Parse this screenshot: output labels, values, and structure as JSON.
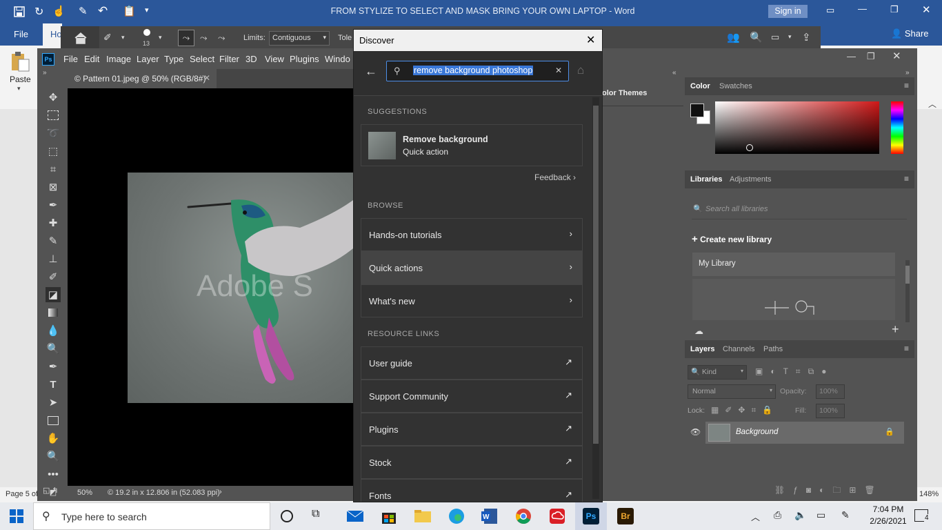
{
  "word": {
    "title": "FROM STYLIZE TO SELECT AND MASK BRING YOUR OWN LAPTOP  -  Word",
    "sign_in": "Sign in",
    "share": "Share",
    "file_tab": "File",
    "home_tab": "Ho",
    "paste_label": "Paste",
    "status_page": "Page 5 of",
    "zoom": "148%"
  },
  "ps_options": {
    "brush_size": "13",
    "limits_label": "Limits:",
    "limits_value": "Contiguous",
    "tolerance_label": "Tole"
  },
  "ps_menu": [
    "File",
    "Edit",
    "Image",
    "Layer",
    "Type",
    "Select",
    "Filter",
    "3D",
    "View",
    "Plugins",
    "Windo"
  ],
  "ps_logo": "Ps",
  "document": {
    "tab_label": "© Pattern 01.jpeg @ 50% (RGB/8#)",
    "watermark": "Adobe S",
    "zoom": "50%",
    "info": "© 19.2 in x 12.806 in (52.083 ppi)"
  },
  "color_themes_label": "olor Themes",
  "color_panel": {
    "tabs": [
      "Color",
      "Swatches"
    ],
    "accent": "#d01818"
  },
  "libraries_panel": {
    "tabs": [
      "Libraries",
      "Adjustments"
    ],
    "search_placeholder": "Search all libraries",
    "create_label": "Create new library",
    "library_name": "My Library"
  },
  "layers_panel": {
    "tabs": [
      "Layers",
      "Channels",
      "Paths"
    ],
    "filter_label": "Kind",
    "blend_mode": "Normal",
    "opacity_label": "Opacity:",
    "opacity_value": "100%",
    "lock_label": "Lock:",
    "fill_label": "Fill:",
    "fill_value": "100%",
    "layer_name": "Background"
  },
  "discover": {
    "title": "Discover",
    "search_value": "remove background photoshop",
    "suggestions_heading": "SUGGESTIONS",
    "suggestion": {
      "title": "Remove background",
      "subtitle": "Quick action"
    },
    "feedback": "Feedback",
    "browse_heading": "BROWSE",
    "browse_items": [
      "Hands-on tutorials",
      "Quick actions",
      "What's new"
    ],
    "resources_heading": "RESOURCE LINKS",
    "resource_items": [
      "User guide",
      "Support Community",
      "Plugins",
      "Stock",
      "Fonts"
    ]
  },
  "taskbar": {
    "search_placeholder": "Type here to search",
    "time": "7:04 PM",
    "date": "2/26/2021",
    "notification_count": "4",
    "apps": [
      "cortana-icon",
      "task-view-icon",
      "mail-icon",
      "store-icon",
      "file-explorer-icon",
      "edge-icon",
      "word-icon",
      "chrome-icon",
      "creative-cloud-icon",
      "photoshop-icon",
      "bridge-icon"
    ]
  }
}
